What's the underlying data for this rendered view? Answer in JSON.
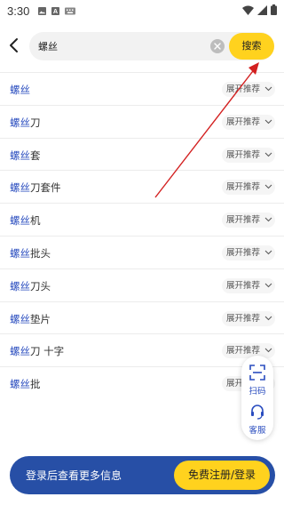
{
  "status_bar": {
    "time": "3:30",
    "icons": [
      "image-icon",
      "a-icon",
      "keyboard-icon",
      "wifi-icon",
      "signal-icon",
      "battery-icon"
    ]
  },
  "header": {
    "back_icon": "back-arrow-icon",
    "search_value": "螺丝",
    "search_button": "搜索",
    "clear_icon": "clear-icon"
  },
  "results": [
    {
      "highlight": "螺丝",
      "rest": "",
      "expand": "展开推荐"
    },
    {
      "highlight": "螺丝",
      "rest": "刀",
      "expand": "展开推荐"
    },
    {
      "highlight": "螺丝",
      "rest": "套",
      "expand": "展开推荐"
    },
    {
      "highlight": "螺丝",
      "rest": "刀套件",
      "expand": "展开推荐"
    },
    {
      "highlight": "螺丝",
      "rest": "机",
      "expand": "展开推荐"
    },
    {
      "highlight": "螺丝",
      "rest": "批头",
      "expand": "展开推荐"
    },
    {
      "highlight": "螺丝",
      "rest": "刀头",
      "expand": "展开推荐"
    },
    {
      "highlight": "螺丝",
      "rest": "垫片",
      "expand": "展开推荐"
    },
    {
      "highlight": "螺丝",
      "rest": "刀 十字",
      "expand": "展开推荐"
    },
    {
      "highlight": "螺丝",
      "rest": "批",
      "expand": "展开推荐"
    }
  ],
  "side_panel": {
    "scan_label": "扫码",
    "service_label": "客服"
  },
  "banner": {
    "text": "登录后查看更多信息",
    "button": "免费注册/登录"
  },
  "colors": {
    "accent_yellow": "#ffd21e",
    "brand_blue": "#274fa6",
    "highlight_blue": "#2a4dbf",
    "annotation_red": "#d32020"
  }
}
